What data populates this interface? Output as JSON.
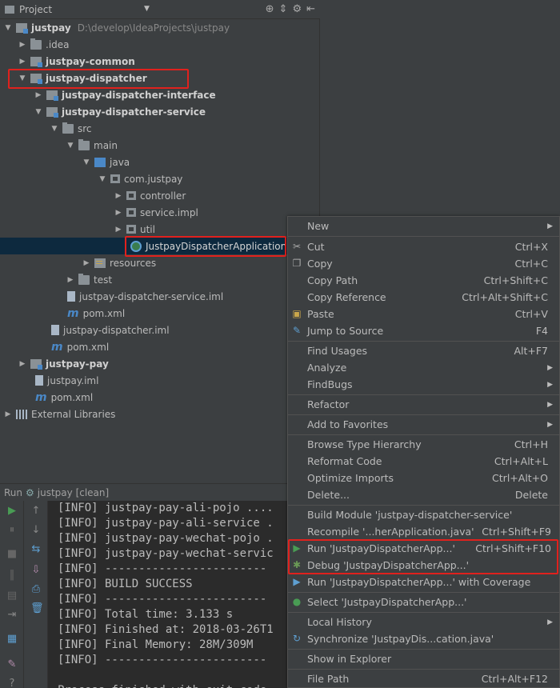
{
  "project_panel": {
    "title": "Project",
    "header_arrow": "▼"
  },
  "tree": {
    "root_label": "justpay",
    "root_path": "D:\\develop\\IdeaProjects\\justpay",
    "idea": ".idea",
    "common": "justpay-common",
    "dispatcher": "justpay-dispatcher",
    "dispatcher_interface": "justpay-dispatcher-interface",
    "dispatcher_service": "justpay-dispatcher-service",
    "src": "src",
    "main": "main",
    "java": "java",
    "com_justpay": "com.justpay",
    "controller": "controller",
    "service_impl": "service.impl",
    "util": "util",
    "app_class": "JustpayDispatcherApplication",
    "resources": "resources",
    "test": "test",
    "service_iml": "justpay-dispatcher-service.iml",
    "service_pom": "pom.xml",
    "dispatcher_iml": "justpay-dispatcher.iml",
    "dispatcher_pom": "pom.xml",
    "pay": "justpay-pay",
    "root_iml": "justpay.iml",
    "root_pom": "pom.xml",
    "external_libs": "External Libraries"
  },
  "run_panel": {
    "label": "Run",
    "config": "justpay [clean]"
  },
  "console": {
    "lines": [
      "[INFO] justpay-pay-ali-pojo ....",
      "[INFO] justpay-pay-ali-service .",
      "[INFO] justpay-pay-wechat-pojo .",
      "[INFO] justpay-pay-wechat-servic",
      "[INFO] ------------------------",
      "[INFO] BUILD SUCCESS",
      "[INFO] ------------------------",
      "[INFO] Total time: 3.133 s",
      "[INFO] Finished at: 2018-03-26T1",
      "[INFO] Final Memory: 28M/309M",
      "[INFO] ------------------------",
      "",
      "Process finished with exit code"
    ]
  },
  "menu": {
    "new": "New",
    "cut": "Cut",
    "cut_sc": "Ctrl+X",
    "copy": "Copy",
    "copy_sc": "Ctrl+C",
    "copy_path": "Copy Path",
    "copy_path_sc": "Ctrl+Shift+C",
    "copy_ref": "Copy Reference",
    "copy_ref_sc": "Ctrl+Alt+Shift+C",
    "paste": "Paste",
    "paste_sc": "Ctrl+V",
    "jump": "Jump to Source",
    "jump_sc": "F4",
    "find_usages": "Find Usages",
    "find_usages_sc": "Alt+F7",
    "analyze": "Analyze",
    "findbugs": "FindBugs",
    "refactor": "Refactor",
    "favorites": "Add to Favorites",
    "browse_hier": "Browse Type Hierarchy",
    "browse_hier_sc": "Ctrl+H",
    "reformat": "Reformat Code",
    "reformat_sc": "Ctrl+Alt+L",
    "optimize": "Optimize Imports",
    "optimize_sc": "Ctrl+Alt+O",
    "delete": "Delete...",
    "delete_sc": "Delete",
    "build_module": "Build Module 'justpay-dispatcher-service'",
    "recompile": "Recompile '...herApplication.java'",
    "recompile_sc": "Ctrl+Shift+F9",
    "run": "Run 'JustpayDispatcherApp...'",
    "run_sc": "Ctrl+Shift+F10",
    "debug": "Debug 'JustpayDispatcherApp...'",
    "run_cov": "Run 'JustpayDispatcherApp...' with Coverage",
    "select": "Select 'JustpayDispatcherApp...'",
    "local_history": "Local History",
    "synchronize": "Synchronize 'JustpayDis...cation.java'",
    "show_explorer": "Show in Explorer",
    "file_path": "File Path",
    "file_path_sc": "Ctrl+Alt+F12"
  },
  "colors": {
    "highlight_box": "#e0211d",
    "selection": "#0d293e",
    "run_green": "#499c54"
  }
}
